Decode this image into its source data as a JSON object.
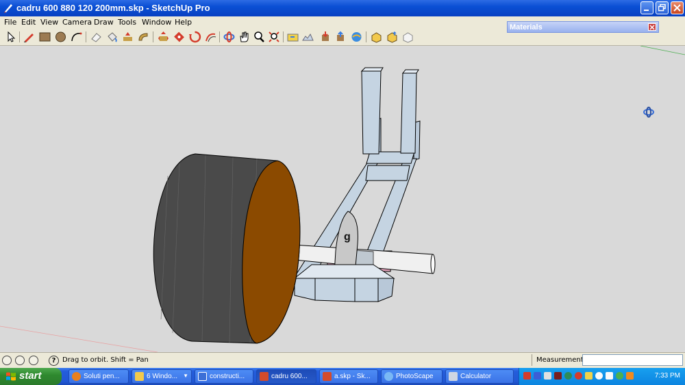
{
  "window": {
    "title": "cadru 600 880 120 200mm.skp - SketchUp Pro",
    "colors": {
      "titlebar": "#0a4fd4",
      "viewport_bg": "#d9d9d9"
    }
  },
  "menu": [
    "File",
    "Edit",
    "View",
    "Camera",
    "Draw",
    "Tools",
    "Window",
    "Help"
  ],
  "toolbar": {
    "tools": [
      "select-icon",
      "pencil-icon",
      "rectangle-icon",
      "circle-icon",
      "arc-icon",
      "eraser-icon",
      "paint-bucket-icon",
      "push-pull-icon",
      "follow-me-icon",
      "move-icon",
      "rotate-icon",
      "scale-icon",
      "offset-icon",
      "orbit-icon",
      "pan-icon",
      "zoom-icon",
      "zoom-extents-icon",
      "add-location-icon",
      "toggle-terrain-icon",
      "get-models-icon",
      "share-model-icon",
      "component-icon",
      "share-component-icon",
      "extension-warehouse-icon"
    ]
  },
  "materials_panel": {
    "title": "Materials"
  },
  "viewport": {
    "labels": {
      "g": "g"
    },
    "colors": {
      "wheel_side": "#4a4a4a",
      "wheel_face": "#8b4a00",
      "frame": "#c5d4e2",
      "axle": "#f0f0f0",
      "bracket": "#e0a0b8"
    }
  },
  "statusbar": {
    "hint": "Drag to orbit.  Shift = Pan",
    "measurements_label": "Measurements",
    "measurements_value": ""
  },
  "taskbar": {
    "start_label": "start",
    "tasks": [
      {
        "label": "Soluti pen...",
        "icon": "firefox-icon",
        "color": "#e8801e"
      },
      {
        "label": "6 Windo...",
        "icon": "folder-icon",
        "color": "#f2c94c"
      },
      {
        "label": "constructi...",
        "icon": "word-icon",
        "color": "#3c6fd6"
      },
      {
        "label": "cadru 600...",
        "icon": "sketchup-icon",
        "color": "#d44b2b"
      },
      {
        "label": "a.skp - Sk...",
        "icon": "sketchup-icon",
        "color": "#d44b2b"
      },
      {
        "label": "PhotoScape",
        "icon": "photoscape-icon",
        "color": "#7ab8f5"
      },
      {
        "label": "Calculator",
        "icon": "calculator-icon",
        "color": "#cfd6e2"
      }
    ],
    "clock": "7:33 PM"
  }
}
